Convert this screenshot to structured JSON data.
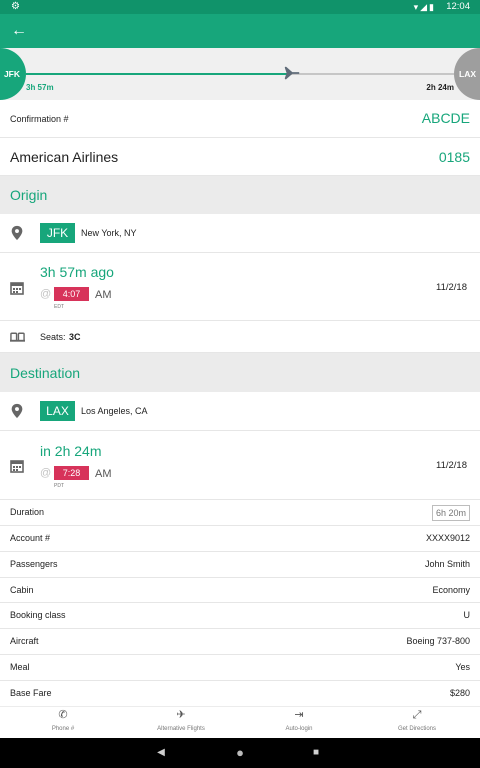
{
  "status_bar": {
    "time": "12:04",
    "settings_icon": "gear-icon",
    "indicators": [
      "wifi-icon",
      "signal-icon",
      "battery-icon"
    ]
  },
  "app_bar": {
    "back_icon": "arrow-left-icon"
  },
  "route": {
    "origin_code": "JFK",
    "destination_code": "LAX",
    "elapsed": "3h 57m",
    "remaining": "2h 24m",
    "progress_fraction": 0.62,
    "plane_icon": "airplane-icon"
  },
  "confirmation": {
    "label": "Confirmation #",
    "value": "ABCDE"
  },
  "flight": {
    "airline": "American Airlines",
    "number": "0185"
  },
  "origin": {
    "heading": "Origin",
    "code": "JFK",
    "city": "New York, NY",
    "relative_time": "3h 57m ago",
    "at": "@",
    "time": "4:07",
    "ampm": "AM",
    "timezone": "EDT",
    "date": "11/2/18",
    "seats_label": "Seats:",
    "seats_value": "3C"
  },
  "destination": {
    "heading": "Destination",
    "code": "LAX",
    "city": "Los Angeles, CA",
    "relative_time": "in 2h 24m",
    "at": "@",
    "time": "7:28",
    "ampm": "AM",
    "timezone": "PDT",
    "date": "11/2/18"
  },
  "details": {
    "duration_label": "Duration",
    "duration_value": "6h 20m",
    "rows": [
      {
        "label": "Account #",
        "value": "XXXX9012"
      },
      {
        "label": "Passengers",
        "value": "John Smith"
      },
      {
        "label": "Cabin",
        "value": "Economy"
      },
      {
        "label": "Booking class",
        "value": "U"
      },
      {
        "label": "Aircraft",
        "value": "Boeing 737-800"
      },
      {
        "label": "Meal",
        "value": "Yes"
      },
      {
        "label": "Base Fare",
        "value": "$280"
      }
    ]
  },
  "bottom_nav": [
    {
      "label": "Phone #",
      "icon": "phone-icon"
    },
    {
      "label": "Alternative Flights",
      "icon": "airplane-icon"
    },
    {
      "label": "Auto-login",
      "icon": "auto-login-icon"
    },
    {
      "label": "Get Directions",
      "icon": "directions-icon"
    }
  ],
  "system_nav": [
    "back-triangle-icon",
    "home-circle-icon",
    "recents-square-icon"
  ],
  "colors": {
    "accent": "#17a67b",
    "status_bar": "#10936a",
    "time_badge": "#d7335a",
    "section_bg": "#ebebeb"
  }
}
